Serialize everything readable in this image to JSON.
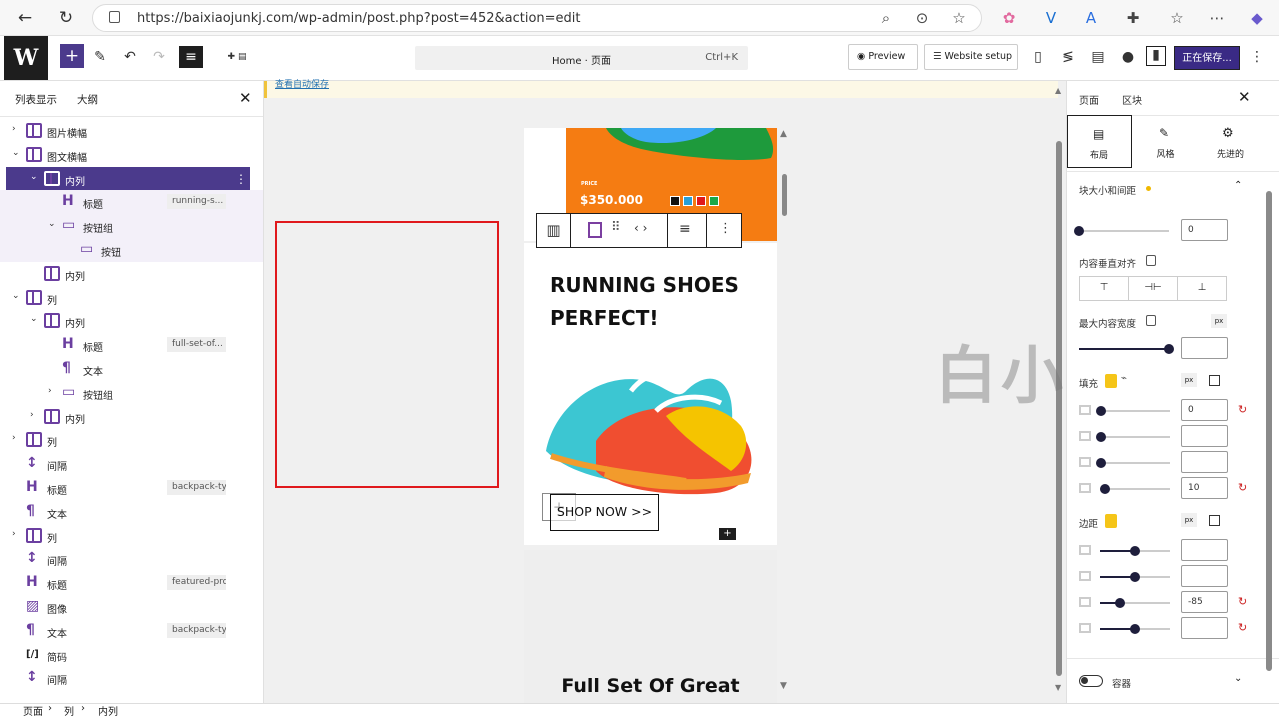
{
  "browser": {
    "url": "https://baixiaojunkj.com/wp-admin/post.php?post=452&action=edit",
    "icons": [
      "back-arrow-icon",
      "refresh-icon",
      "lock-icon",
      "zoom-icon",
      "reader-icon",
      "star-icon",
      "extension-icon",
      "copilot-icon"
    ]
  },
  "toolbar": {
    "command_text": "Home · 页面",
    "command_shortcut": "Ctrl+K",
    "preview_label": "Preview",
    "website_setup_label": "Website setup",
    "save_label": "正在保存..."
  },
  "left_panel": {
    "tab_list": "列表显示",
    "tab_outline": "大纲",
    "items": [
      {
        "label": "图片横幅",
        "badge": ""
      },
      {
        "label": "图文横幅",
        "badge": ""
      },
      {
        "label": "内列",
        "badge": ""
      },
      {
        "label": "标题",
        "badge": "running-s..."
      },
      {
        "label": "按钮组",
        "badge": ""
      },
      {
        "label": "按钮",
        "badge": ""
      },
      {
        "label": "内列",
        "badge": ""
      },
      {
        "label": "列",
        "badge": ""
      },
      {
        "label": "内列",
        "badge": ""
      },
      {
        "label": "标题",
        "badge": "full-set-of..."
      },
      {
        "label": "文本",
        "badge": ""
      },
      {
        "label": "按钮组",
        "badge": ""
      },
      {
        "label": "内列",
        "badge": ""
      },
      {
        "label": "列",
        "badge": ""
      },
      {
        "label": "间隔",
        "badge": ""
      },
      {
        "label": "标题",
        "badge": "backpack-ty..."
      },
      {
        "label": "文本",
        "badge": ""
      },
      {
        "label": "列",
        "badge": ""
      },
      {
        "label": "间隔",
        "badge": ""
      },
      {
        "label": "标题",
        "badge": "featured-pro..."
      },
      {
        "label": "图像",
        "badge": ""
      },
      {
        "label": "文本",
        "badge": "backpack-ty..."
      },
      {
        "label": "简码",
        "badge": ""
      },
      {
        "label": "间隔",
        "badge": ""
      }
    ]
  },
  "canvas": {
    "notice": "查看自动保存",
    "price_label": "PRICE",
    "price": "$350.000",
    "swatch_colors": [
      "#111111",
      "#2a9fd6",
      "#e0191c",
      "#1aa84a"
    ],
    "heading": "RUNNING SHOES PERFECT!",
    "button": "SHOP NOW >>",
    "lower_heading": "Full Set Of Great"
  },
  "right_panel": {
    "tab_page": "页面",
    "tab_block": "区块",
    "sub_layout": "布局",
    "sub_style": "风格",
    "sub_advanced": "先进的",
    "section_size": "块大小和间距",
    "vertical_align": "内容垂直对齐",
    "max_width": "最大内容宽度",
    "padding": "填充",
    "margin": "边距",
    "unit": "px",
    "container": "容器",
    "size_value": "0",
    "padding_values": [
      "0",
      "",
      "",
      "10"
    ],
    "margin_values": [
      "",
      "",
      "-85",
      ""
    ]
  },
  "watermark": "白小菌",
  "status": {
    "crumbs": [
      "页面",
      "列",
      "内列"
    ]
  }
}
